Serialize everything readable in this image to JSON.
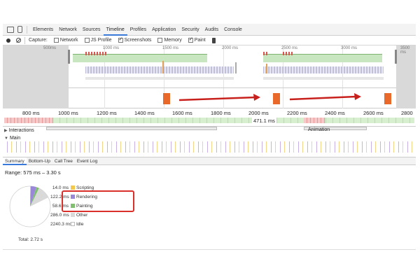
{
  "devtools": {
    "tabs": [
      {
        "label": "Elements"
      },
      {
        "label": "Network"
      },
      {
        "label": "Sources"
      },
      {
        "label": "Timeline"
      },
      {
        "label": "Profiles"
      },
      {
        "label": "Application"
      },
      {
        "label": "Security"
      },
      {
        "label": "Audits"
      },
      {
        "label": "Console"
      }
    ],
    "active_tab": "Timeline"
  },
  "controls": {
    "capture_label": "Capture:",
    "options": [
      {
        "label": "Network",
        "checked": false
      },
      {
        "label": "JS Profile",
        "checked": false
      },
      {
        "label": "Screenshots",
        "checked": true
      },
      {
        "label": "Memory",
        "checked": false
      },
      {
        "label": "Paint",
        "checked": true
      }
    ]
  },
  "overview": {
    "ticks": [
      "500ms",
      "1000 ms",
      "1500 ms",
      "2000 ms",
      "2500 ms",
      "3000 ms",
      "3500 ms"
    ]
  },
  "ruler": {
    "ticks": [
      "800 ms",
      "1000 ms",
      "1200 ms",
      "1400 ms",
      "1600 ms",
      "1800 ms",
      "2000 ms",
      "2200 ms",
      "2400 ms",
      "2600 ms",
      "2800"
    ],
    "selected_duration": "471.1 ms"
  },
  "tracks": {
    "interactions_label": "Interactions",
    "animation_label": "Animation",
    "main_label": "Main"
  },
  "panel": {
    "tabs": [
      "Summary",
      "Bottom-Up",
      "Call Tree",
      "Event Log"
    ],
    "range": "Range: 575 ms – 3.30 s",
    "legend": [
      {
        "value": "14.0 ms",
        "label": "Scripting",
        "color": "#f2c94c"
      },
      {
        "value": "122.2 ms",
        "label": "Rendering",
        "color": "#9b87d8"
      },
      {
        "value": "58.6 ms",
        "label": "Painting",
        "color": "#7fbf6f"
      },
      {
        "value": "286.0 ms",
        "label": "Other",
        "color": "#d9d9d9"
      },
      {
        "value": "2240.3 ms",
        "label": "Idle",
        "color": "#ffffff"
      }
    ],
    "total": "Total: 2.72 s"
  }
}
